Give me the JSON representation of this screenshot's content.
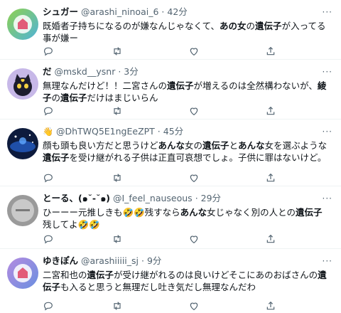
{
  "tweets": [
    {
      "name": "シュガー",
      "handle": "@arashi_ninoai_6",
      "sep": "·",
      "time": "42分",
      "more": "···",
      "avatar_text": "Thank You Stay Arashi",
      "text": [
        {
          "t": "既婚者子持ちになるのが嫌なんじゃなくて、"
        },
        {
          "t": "あの女",
          "b": true
        },
        {
          "t": "の"
        },
        {
          "t": "遺伝子",
          "b": true
        },
        {
          "t": "が入ってる事が嫌ー"
        }
      ]
    },
    {
      "name": "だ",
      "handle": "@mskd__ysnr",
      "sep": "·",
      "time": "3分",
      "more": "···",
      "text": [
        {
          "t": "無理なんだけど！！二宮さんの"
        },
        {
          "t": "遺伝子",
          "b": true
        },
        {
          "t": "が増えるのは全然構わないが、"
        },
        {
          "t": "綾子",
          "b": true
        },
        {
          "t": "の"
        },
        {
          "t": "遺伝子",
          "b": true
        },
        {
          "t": "だけはまじいらん"
        }
      ]
    },
    {
      "name": "",
      "name_emoji": "👋",
      "handle": "@DhTWQ5E1ngEeZPT",
      "sep": "·",
      "time": "45分",
      "more": "···",
      "text": [
        {
          "t": "顔も頭も良い方だと思うけど"
        },
        {
          "t": "あんな",
          "b": true
        },
        {
          "t": "女の"
        },
        {
          "t": "遺伝子",
          "b": true
        },
        {
          "t": "と"
        },
        {
          "t": "あんな",
          "b": true
        },
        {
          "t": "女を選ぶような"
        },
        {
          "t": "遺伝子",
          "b": true
        },
        {
          "t": "を受け継がれる子供は正直可哀想でしょ。子供に罪はないけど。"
        }
      ]
    },
    {
      "name": "とーる、(๑˘-˘๑)",
      "handle": "@I_feel_nauseous",
      "sep": "·",
      "time": "29分",
      "more": "···",
      "text": [
        {
          "t": "ひーーー元推しきも🤣🤣残すなら"
        },
        {
          "t": "あんな",
          "b": true
        },
        {
          "t": "女じゃなく別の人との"
        },
        {
          "t": "遺伝子",
          "b": true
        },
        {
          "t": "残してよ🤣🤣"
        }
      ]
    },
    {
      "name": "ゆきぽん",
      "handle": "@arashiiiii_sj",
      "sep": "·",
      "time": "9分",
      "more": "···",
      "avatar_text": "Thank You Stay Arashi",
      "text": [
        {
          "t": "二宮和也の"
        },
        {
          "t": "遺伝子",
          "b": true
        },
        {
          "t": "が受け継がれるのは良いけどそこにあのおばさんの"
        },
        {
          "t": "遺伝子",
          "b": true
        },
        {
          "t": "も入ると思うと無理だし吐き気だし無理なんだわ"
        }
      ]
    }
  ],
  "colors": {
    "text": "#0f1419",
    "secondary": "#536471",
    "divider": "#eff3f4"
  },
  "icons": [
    "reply-icon",
    "retweet-icon",
    "like-icon",
    "share-icon",
    "more-icon"
  ]
}
